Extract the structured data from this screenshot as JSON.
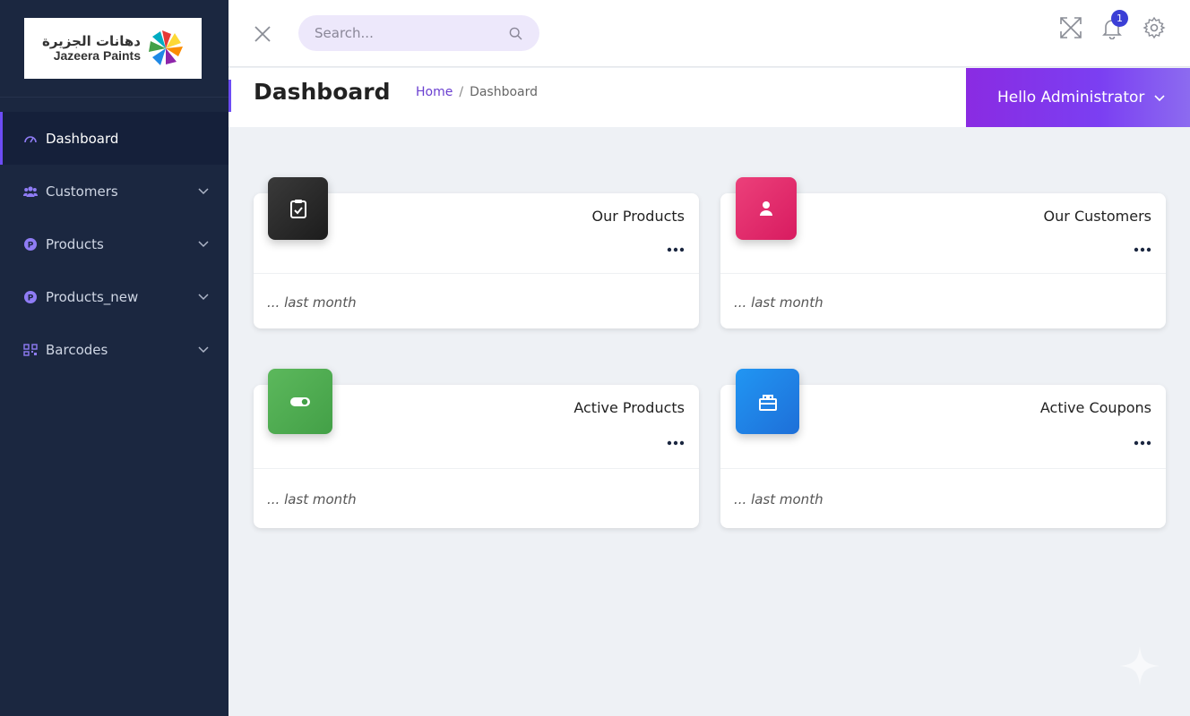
{
  "logo": {
    "arabic": "دهانات الجزيرة",
    "english": "Jazeera Paints"
  },
  "sidebar": {
    "items": [
      {
        "label": "Dashboard",
        "icon": "gauge-icon",
        "active": true
      },
      {
        "label": "Customers",
        "icon": "users-icon"
      },
      {
        "label": "Products",
        "icon": "product-p-icon"
      },
      {
        "label": "Products_new",
        "icon": "product-p-icon"
      },
      {
        "label": "Barcodes",
        "icon": "barcode-icon"
      }
    ]
  },
  "topbar": {
    "search_placeholder": "Search...",
    "notification_count": "1"
  },
  "page": {
    "title": "Dashboard",
    "breadcrumb": {
      "home": "Home",
      "separator": "/",
      "current": "Dashboard"
    }
  },
  "user": {
    "greeting": "Hello Administrator"
  },
  "cards": [
    {
      "title": "Our Products",
      "footer": "... last month",
      "icon": "clipboard-check-icon",
      "color": "#2b2b2b"
    },
    {
      "title": "Our Customers",
      "footer": "... last month",
      "icon": "user-icon",
      "color": "#e91e63"
    },
    {
      "title": "Active Products",
      "footer": "... last month",
      "icon": "toggle-icon",
      "color": "#4caf50"
    },
    {
      "title": "Active Coupons",
      "footer": "... last month",
      "icon": "gift-box-icon",
      "color": "#1e88e5"
    }
  ],
  "colors": {
    "sidebar": "#1b2740",
    "accent": "#6d4cf5",
    "hello_gradient_start": "#8a2be2"
  }
}
